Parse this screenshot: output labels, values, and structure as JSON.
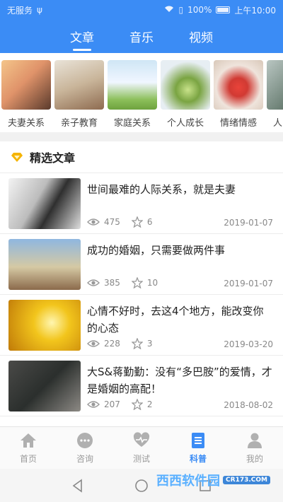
{
  "status": {
    "carrier": "无服务",
    "battery": "100%",
    "time": "上午10:00"
  },
  "tabs": [
    {
      "label": "文章",
      "active": true
    },
    {
      "label": "音乐",
      "active": false
    },
    {
      "label": "视频",
      "active": false
    }
  ],
  "categories": [
    {
      "label": "夫妻关系"
    },
    {
      "label": "亲子教育"
    },
    {
      "label": "家庭关系"
    },
    {
      "label": "个人成长"
    },
    {
      "label": "情绪情感"
    },
    {
      "label": "人际关系"
    }
  ],
  "section": {
    "title": "精选文章"
  },
  "articles": [
    {
      "title": "世间最难的人际关系，就是夫妻",
      "views": "475",
      "stars": "6",
      "date": "2019-01-07"
    },
    {
      "title": "成功的婚姻，只需要做两件事",
      "views": "385",
      "stars": "10",
      "date": "2019-01-07"
    },
    {
      "title": "心情不好时，去这4个地方，能改变你的心态",
      "views": "228",
      "stars": "3",
      "date": "2019-03-20"
    },
    {
      "title": "大S&蒋勤勤：没有“多巴胺”的爱情，才是婚姻的高配！",
      "views": "207",
      "stars": "2",
      "date": "2018-08-02"
    }
  ],
  "bottom_nav": [
    {
      "label": "首页",
      "icon": "home-icon"
    },
    {
      "label": "咨询",
      "icon": "chat-icon"
    },
    {
      "label": "测试",
      "icon": "heart-icon"
    },
    {
      "label": "科普",
      "icon": "document-icon",
      "active": true
    },
    {
      "label": "我的",
      "icon": "person-icon"
    }
  ],
  "watermark": {
    "text": "西西软件园",
    "sub": "CR173.COM"
  },
  "colors": {
    "accent": "#3b8cf5",
    "diamond": "#f5b400"
  }
}
